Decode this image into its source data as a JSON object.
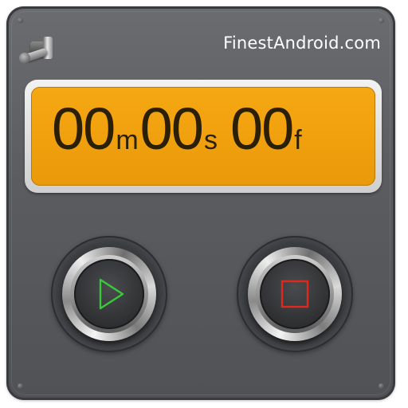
{
  "header": {
    "brand": "FinestAndroid.com"
  },
  "timer": {
    "minutes": "00",
    "minutes_unit": "m",
    "seconds": "00",
    "seconds_unit": "s",
    "frames": "00",
    "frames_unit": "f"
  },
  "controls": {
    "play_icon": "play-icon",
    "stop_icon": "stop-icon",
    "play_color": "#39c83a",
    "stop_color": "#e0281e"
  },
  "colors": {
    "body": "#5a5c60",
    "display": "#f2a20e",
    "digits": "#2b2006"
  }
}
